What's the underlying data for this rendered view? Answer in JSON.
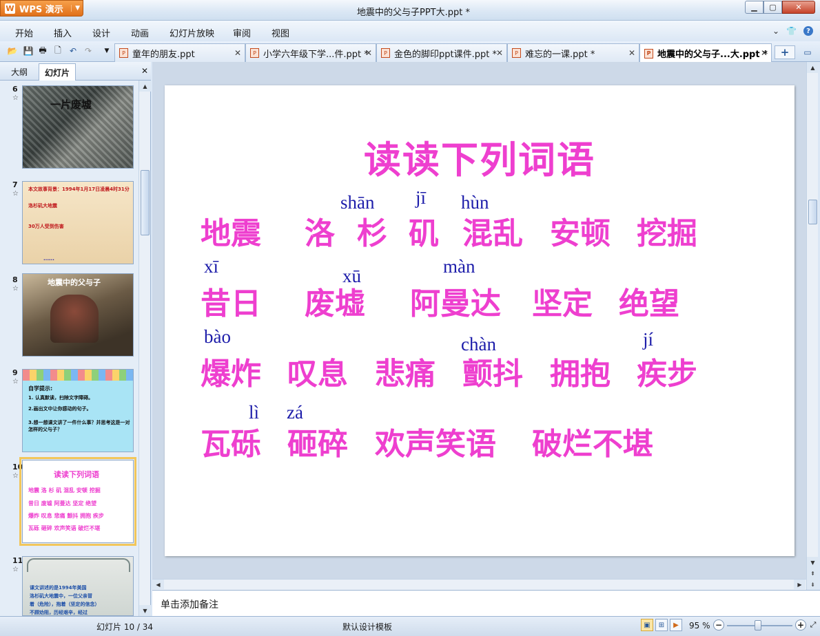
{
  "app": {
    "name": "WPS 演示",
    "window_title": "地震中的父与子PPT大.ppt *"
  },
  "menu": [
    "开始",
    "插入",
    "设计",
    "动画",
    "幻灯片放映",
    "审阅",
    "视图"
  ],
  "tabs": [
    {
      "label": "童年的朋友.ppt"
    },
    {
      "label": "小学六年级下学...件.ppt *"
    },
    {
      "label": "金色的脚印ppt课件.ppt *"
    },
    {
      "label": "难忘的一课.ppt *"
    },
    {
      "label": "地震中的父与子...大.ppt *"
    }
  ],
  "sidebar": {
    "tabs": [
      "大纲",
      "幻灯片"
    ],
    "thumbnails": [
      {
        "num": "6",
        "caption": "一片废墟"
      },
      {
        "num": "7",
        "lines": [
          "本文故事背景：1994年1月17日凌晨4时31分",
          "洛杉矶大地震",
          "30万人受到伤害",
          "......"
        ]
      },
      {
        "num": "8",
        "caption": "地震中的父与子"
      },
      {
        "num": "9",
        "lines": [
          "自学提示:",
          "1. 认真默读，扫除文字障碍。",
          "2.画出文中让你感动的句子。",
          "3.想一想课文讲了一件什么事？并思考这是一对怎样的父与子？"
        ]
      },
      {
        "num": "10",
        "title": "读读下列词语",
        "rows": [
          "地震 洛 杉 矶 混乱 安顿 挖掘",
          "昔日 废墟 阿曼达 坚定 绝望",
          "爆炸 叹息 悲痛 颤抖 拥抱 疾步",
          "瓦砾 砸碎 欢声笑语 破烂不堪"
        ]
      },
      {
        "num": "11",
        "lines": [
          "课文讲述的是1994年美国",
          "洛杉矶大地震中，一位父亲冒",
          "着（危险），抱着（坚定的信念）",
          "不顾劝阻，历经艰辛，经过"
        ]
      }
    ]
  },
  "slide": {
    "title": "读读下列词语",
    "pinyin": [
      "shān",
      "jī",
      "hùn",
      "xī",
      "xū",
      "màn",
      "bào",
      "chàn",
      "jí",
      "lì",
      "zá"
    ],
    "rows": [
      [
        "地震",
        "洛",
        "杉",
        "矶",
        "混乱",
        "安顿",
        "挖掘"
      ],
      [
        "昔日",
        "废墟",
        "阿曼达",
        "坚定",
        "绝望"
      ],
      [
        "爆炸",
        "叹息",
        "悲痛",
        "颤抖",
        "拥抱",
        "疾步"
      ],
      [
        "瓦砾",
        "砸碎",
        "欢声笑语",
        "破烂不堪"
      ]
    ]
  },
  "notes_placeholder": "单击添加备注",
  "status": {
    "slide_indicator": "幻灯片 10 / 34",
    "design_template": "默认设计模板",
    "zoom": "95 %"
  },
  "colors": {
    "word": "#ee3fcf",
    "pinyin": "#1d1daa",
    "accent": "#e0701b"
  }
}
